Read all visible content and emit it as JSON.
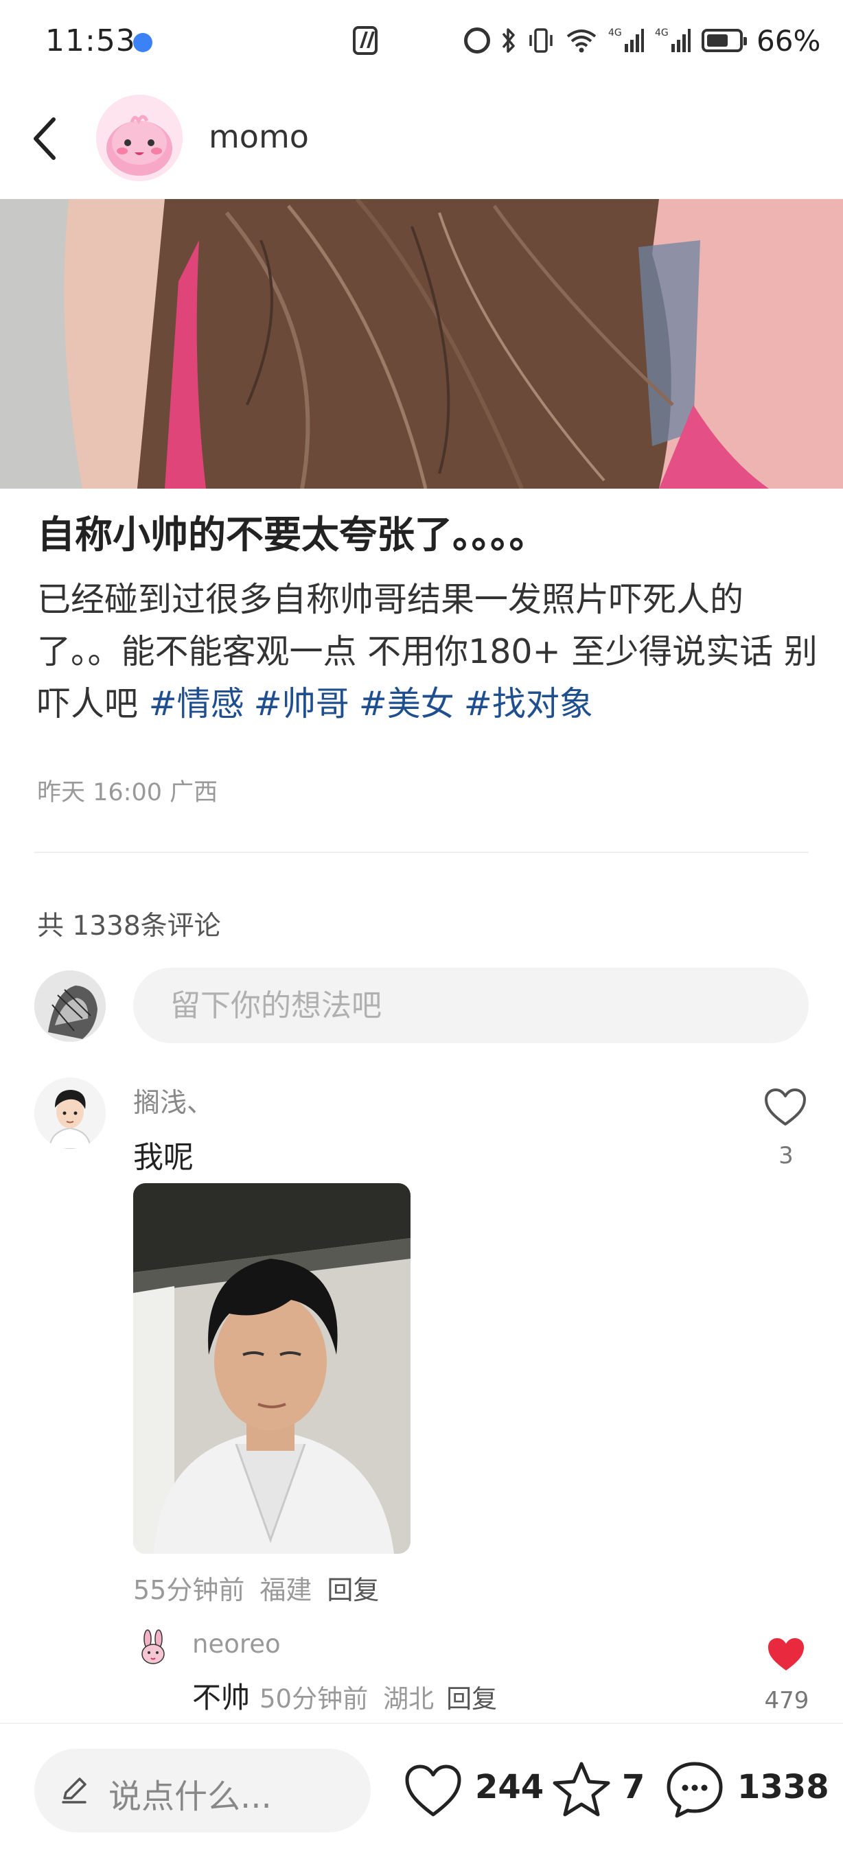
{
  "status_bar": {
    "time": "11:53",
    "battery": "66%",
    "icons": [
      "location-dot-icon",
      "nfc-icon",
      "alarm-icon",
      "bluetooth-icon",
      "vibrate-icon",
      "wifi-icon",
      "signal-4g-icon",
      "signal-4g-icon",
      "battery-icon"
    ],
    "network_labels": [
      "4G",
      "4G"
    ]
  },
  "header": {
    "author": "momo",
    "back_icon": "chevron-left-icon"
  },
  "post": {
    "title": "自称小帅的不要太夸张了。。。。",
    "body": "已经碰到过很多自称帅哥结果一发照片吓死人的了。。能不能客观一点 不用你180+ 至少得说实话 别吓人吧",
    "tags": [
      "#情感",
      "#帅哥",
      "#美女",
      "#找对象"
    ],
    "meta": "昨天 16:00 广西",
    "tag_color": "#1f4f8f"
  },
  "comments": {
    "count_label": "共 1338条评论",
    "input_placeholder": "留下你的想法吧",
    "items": [
      {
        "user": "搁浅、",
        "text": "我呢",
        "likes": "3",
        "time": "55分钟前",
        "location": "福建",
        "reply_label": "回复",
        "replies": [
          {
            "user": "neoreo",
            "text": "不帅",
            "time": "50分钟前",
            "location": "湖北",
            "reply_label": "回复",
            "likes": "479",
            "liked": true
          }
        ]
      }
    ]
  },
  "bottom_bar": {
    "say_placeholder": "说点什么...",
    "like_count": "244",
    "star_count": "7",
    "comment_count": "1338",
    "like_color": "#e8293e"
  }
}
